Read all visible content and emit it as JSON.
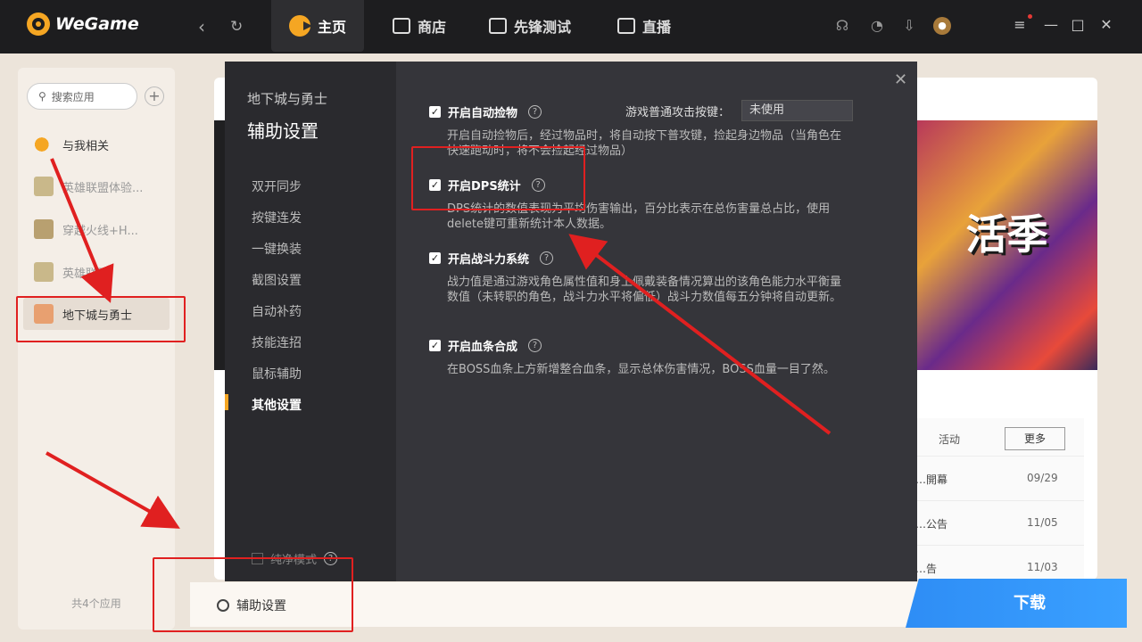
{
  "app": {
    "name": "WeGame"
  },
  "topnav": {
    "tabs": [
      {
        "label": "主页",
        "icon": "wegame-home-icon"
      },
      {
        "label": "商店",
        "icon": "store-bag-icon"
      },
      {
        "label": "先锋测试",
        "icon": "pioneer-test-icon"
      },
      {
        "label": "直播",
        "icon": "live-play-icon"
      }
    ]
  },
  "sidebar": {
    "search_placeholder": "搜索应用",
    "items": [
      {
        "label": "与我相关"
      },
      {
        "label": "英雄联盟体验..."
      },
      {
        "label": "穿越火线+H..."
      },
      {
        "label": "英雄联盟"
      },
      {
        "label": "地下城与勇士"
      }
    ],
    "footer": "共4个应用"
  },
  "modal": {
    "game": "地下城与勇士",
    "title": "辅助设置",
    "nav": [
      "双开同步",
      "按键连发",
      "一键换装",
      "截图设置",
      "自动补药",
      "技能连招",
      "鼠标辅助",
      "其他设置"
    ],
    "pure_mode": "纯净模式",
    "keybind_label": "游戏普通攻击按键：",
    "keybind_value": "未使用",
    "options": [
      {
        "label": "开启自动捡物",
        "checked": true,
        "desc": "开启自动捡物后，经过物品时，将自动按下普攻键，捡起身边物品（当角色在快速跑动时，将不会捡起经过物品）"
      },
      {
        "label": "开启DPS统计",
        "checked": true,
        "desc": "DPS统计的数值表现为平均伤害输出，百分比表示在总伤害量总占比，使用delete键可重新统计本人数据。"
      },
      {
        "label": "开启战斗力系统",
        "checked": true,
        "desc": "战力值是通过游戏角色属性值和身上佩戴装备情况算出的该角色能力水平衡量数值（未转职的角色，战斗力水平将偏低）战斗力数值每五分钟将自动更新。"
      },
      {
        "label": "开启血条合成",
        "checked": true,
        "desc": "在BOSS血条上方新增整合血条，显示总体伤害情况，BOSS血量一目了然。"
      }
    ]
  },
  "news": {
    "tab": "活动",
    "more": "更多",
    "rows": [
      {
        "title": "…開幕",
        "date": "09/29"
      },
      {
        "title": "…公告",
        "date": "11/05"
      },
      {
        "title": "…告",
        "date": "11/03"
      }
    ]
  },
  "banner_text": "活季",
  "footer": {
    "assist_label": "辅助设置",
    "download_label": "下载"
  },
  "colors": {
    "accent": "#f5a623",
    "download": "#3aa0ff",
    "annotation": "#e02020"
  }
}
